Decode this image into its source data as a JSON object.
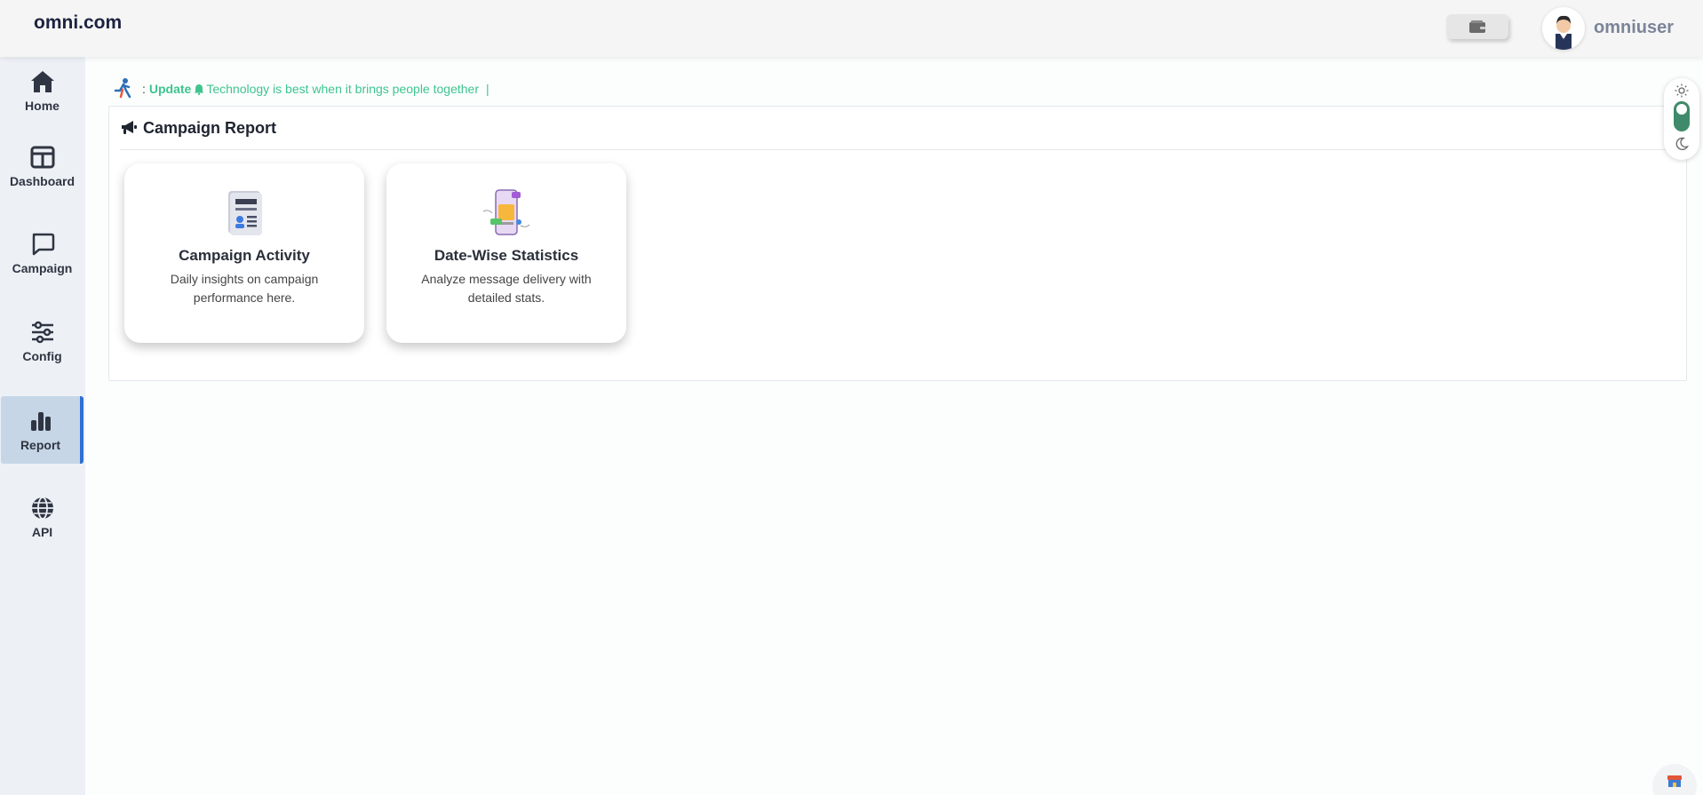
{
  "header": {
    "brand": "omni.com",
    "username": "omniuser"
  },
  "sidebar": {
    "items": [
      {
        "label": "Home",
        "icon": "home-icon"
      },
      {
        "label": "Dashboard",
        "icon": "layout-icon"
      },
      {
        "label": "Campaign",
        "icon": "chat-icon"
      },
      {
        "label": "Config",
        "icon": "sliders-icon"
      },
      {
        "label": "Report",
        "icon": "bar-chart-icon",
        "active": true
      },
      {
        "label": "API",
        "icon": "globe-icon"
      }
    ]
  },
  "ticker": {
    "prefix": ":",
    "update_label": "Update",
    "message": "Technology is best when it brings people together",
    "cursor": "|"
  },
  "panel": {
    "title": "Campaign Report",
    "cards": [
      {
        "title": "Campaign Activity",
        "description": "Daily insights on campaign performance here."
      },
      {
        "title": "Date-Wise Statistics",
        "description": "Analyze message delivery with detailed stats."
      }
    ]
  },
  "colors": {
    "accent_green": "#3ec48f",
    "active_nav_bg": "#c6d6e6",
    "active_nav_border": "#2f6fd2",
    "toggle_green": "#3f8a6a"
  }
}
